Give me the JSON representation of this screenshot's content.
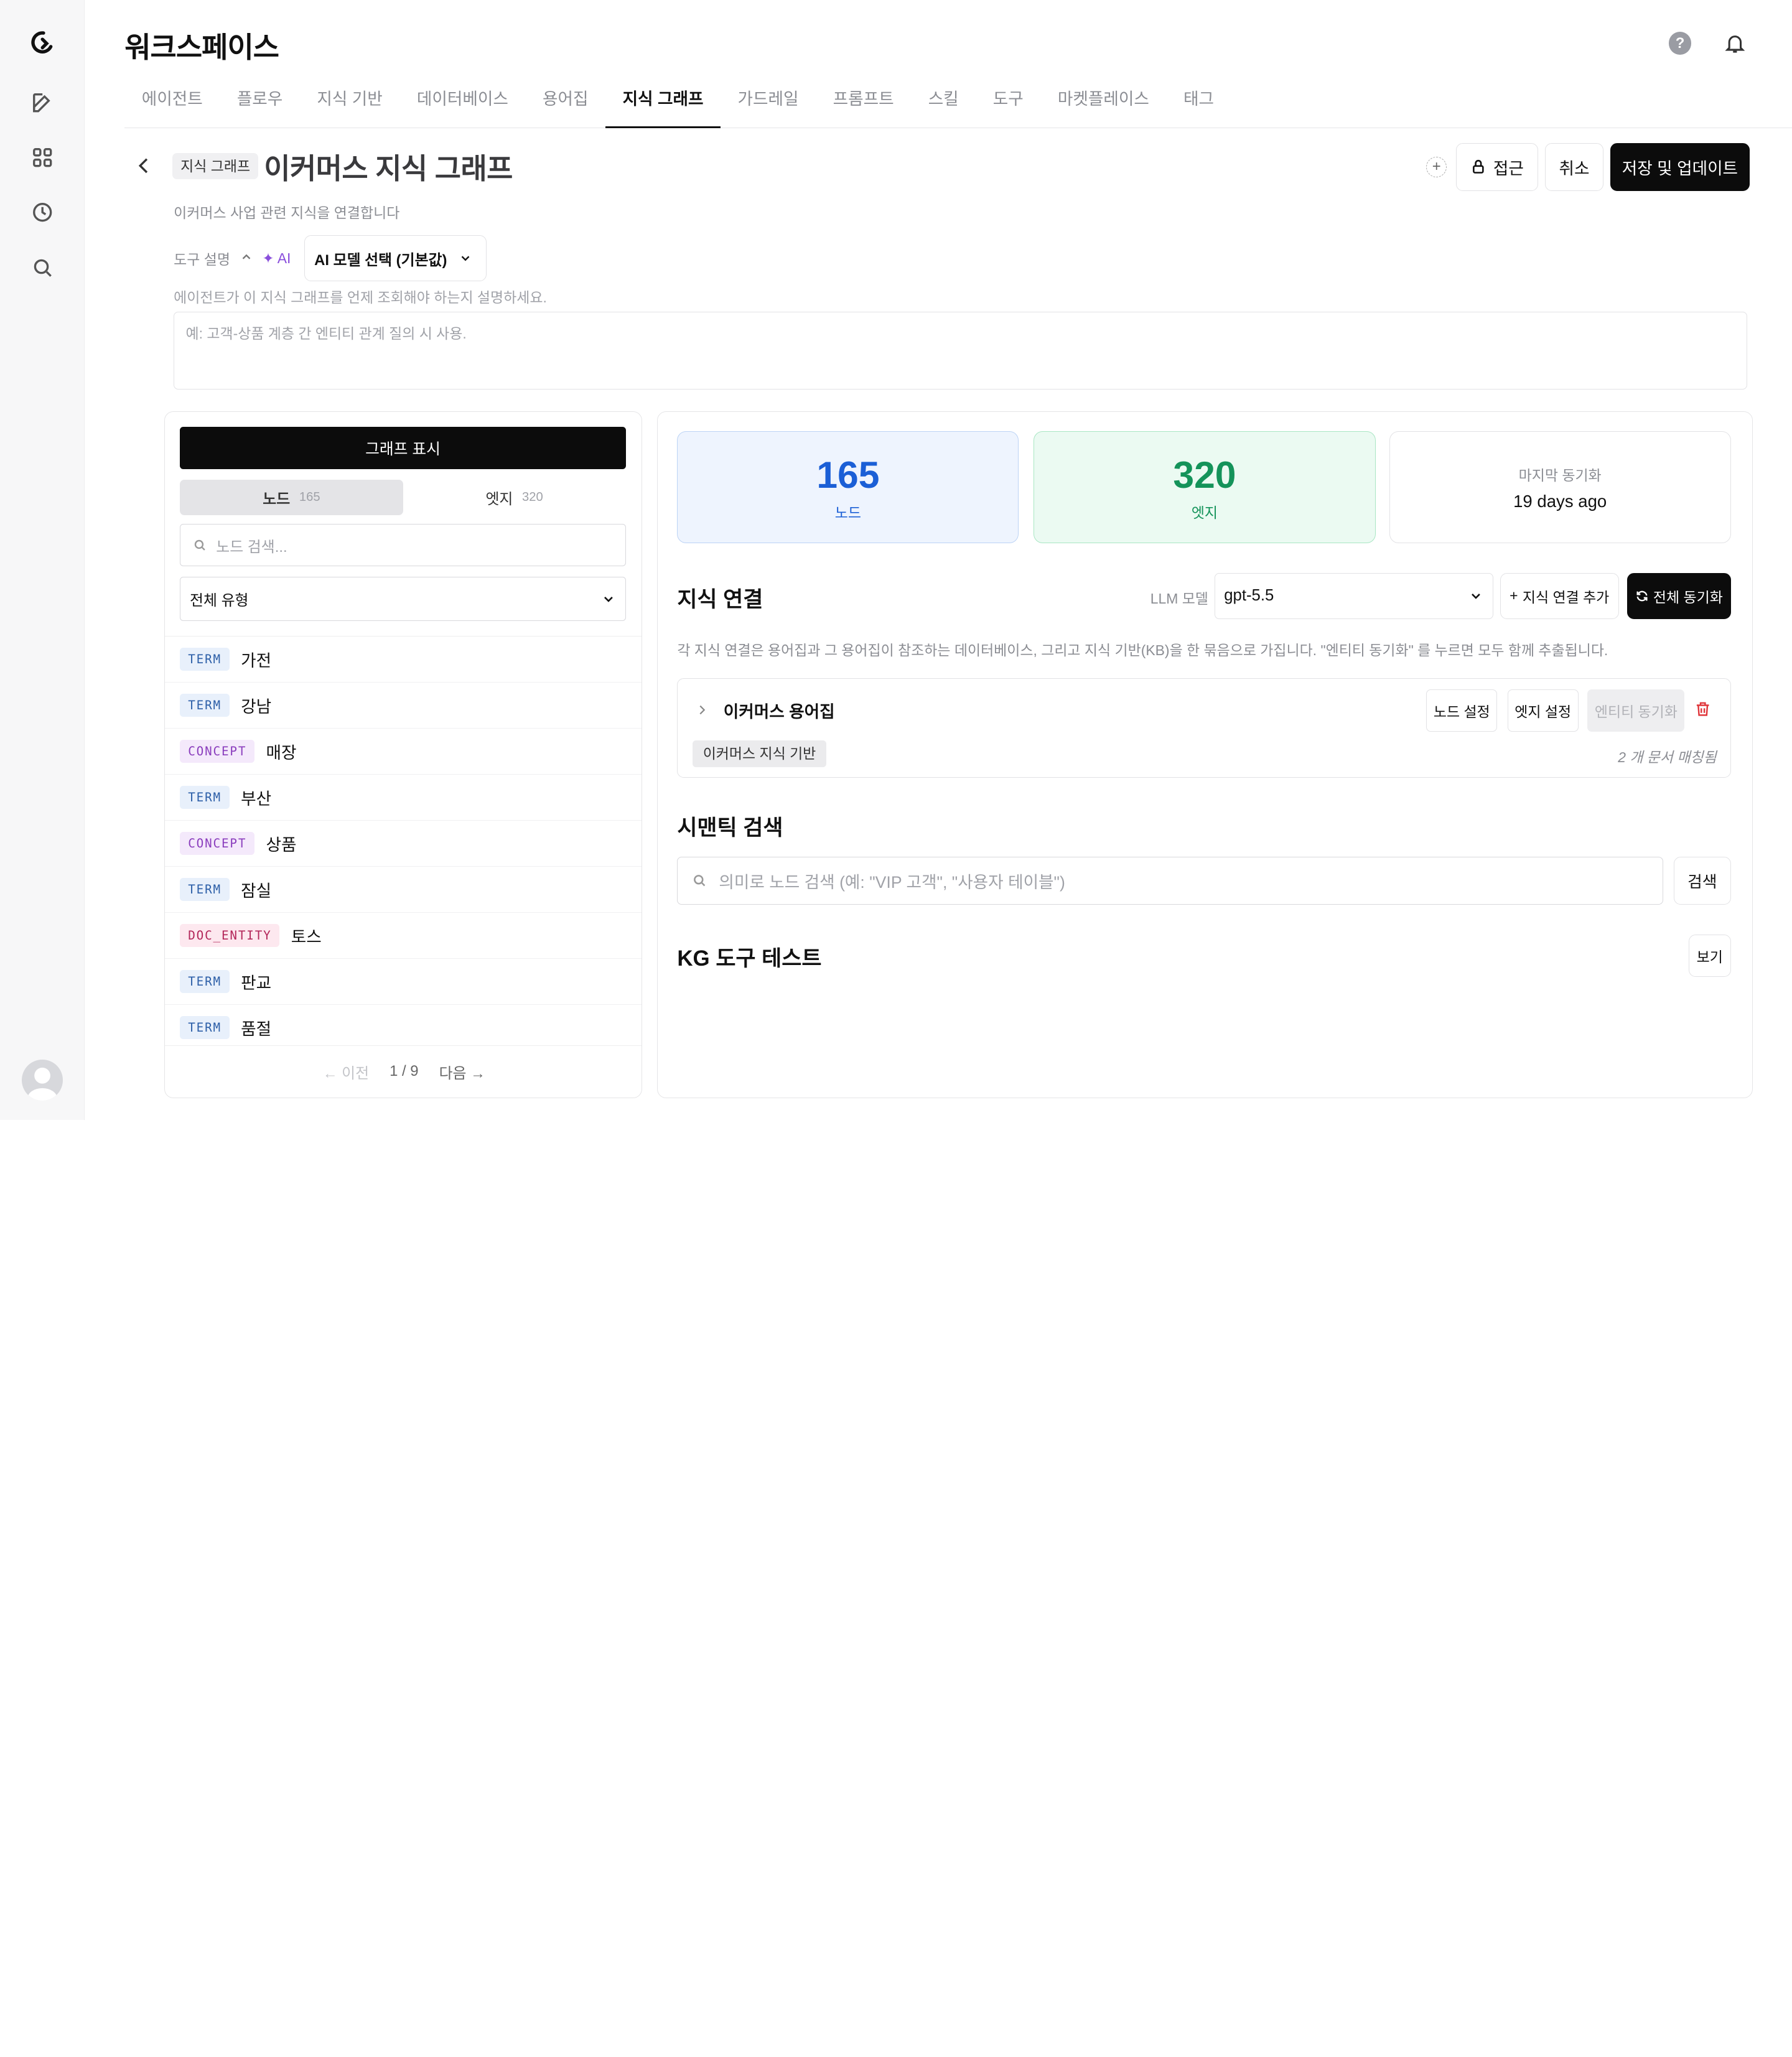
{
  "app": {
    "workspace_title": "워크스페이스"
  },
  "tabs": [
    {
      "label": "에이전트"
    },
    {
      "label": "플로우"
    },
    {
      "label": "지식 기반"
    },
    {
      "label": "데이터베이스"
    },
    {
      "label": "용어집"
    },
    {
      "label": "지식 그래프",
      "active": true
    },
    {
      "label": "가드레일"
    },
    {
      "label": "프롬프트"
    },
    {
      "label": "스킬"
    },
    {
      "label": "도구"
    },
    {
      "label": "마켓플레이스"
    },
    {
      "label": "태그"
    }
  ],
  "page": {
    "breadcrumb": "지식 그래프",
    "title": "이커머스 지식 그래프",
    "description": "이커머스 사업 관련 지식을 연결합니다",
    "access_label": "접근",
    "cancel_label": "취소",
    "save_label": "저장 및 업데이트"
  },
  "tool": {
    "label": "도구 설명",
    "ai_label": "AI",
    "model_select": "AI 모델 선택 (기본값)",
    "help": "에이전트가 이 지식 그래프를 언제 조회해야 하는지 설명하세요.",
    "placeholder": "예: 고객-상품 계층 간 엔티티 관계 질의 시 사용."
  },
  "left": {
    "show_graph": "그래프 표시",
    "seg_nodes_label": "노드",
    "seg_nodes_count": "165",
    "seg_edges_label": "엣지",
    "seg_edges_count": "320",
    "search_placeholder": "노드 검색...",
    "type_filter": "전체 유형",
    "nodes": [
      {
        "type": "TERM",
        "label": "가전"
      },
      {
        "type": "TERM",
        "label": "강남"
      },
      {
        "type": "CONCEPT",
        "label": "매장"
      },
      {
        "type": "TERM",
        "label": "부산"
      },
      {
        "type": "CONCEPT",
        "label": "상품"
      },
      {
        "type": "TERM",
        "label": "잠실"
      },
      {
        "type": "DOC_ENTITY",
        "label": "토스"
      },
      {
        "type": "TERM",
        "label": "판교"
      },
      {
        "type": "TERM",
        "label": "품절"
      }
    ],
    "pager": {
      "prev": "← 이전",
      "page": "1 / 9",
      "next": "다음 →"
    }
  },
  "stats": {
    "nodes_value": "165",
    "nodes_label": "노드",
    "edges_value": "320",
    "edges_label": "엣지",
    "sync_label": "마지막 동기화",
    "sync_value": "19 days ago"
  },
  "knowledge": {
    "title": "지식 연결",
    "llm_label": "LLM 모델",
    "llm_value": "gpt-5.5",
    "add_label": "지식 연결 추가",
    "sync_all_label": "전체 동기화",
    "description": "각 지식 연결은 용어집과 그 용어집이 참조하는 데이터베이스, 그리고 지식 기반(KB)을 한 묶음으로 가집니다. \"엔티티 동기화\" 를 누르면 모두 함께 추출됩니다.",
    "connection": {
      "name": "이커머스 용어집",
      "node_settings": "노드 설정",
      "edge_settings": "엣지 설정",
      "entity_sync": "엔티티 동기화",
      "kb_tag": "이커머스 지식 기반",
      "matched": "2 개 문서 매칭됨"
    }
  },
  "semantic": {
    "title": "시맨틱 검색",
    "placeholder": "의미로 노드 검색 (예: \"VIP 고객\", \"사용자 테이블\")",
    "button": "검색"
  },
  "kg_test": {
    "title": "KG 도구 테스트",
    "button": "보기"
  },
  "colors": {
    "accent_blue": "#1b5fd6",
    "accent_green": "#14935a",
    "primary": "#0c0c0c"
  }
}
